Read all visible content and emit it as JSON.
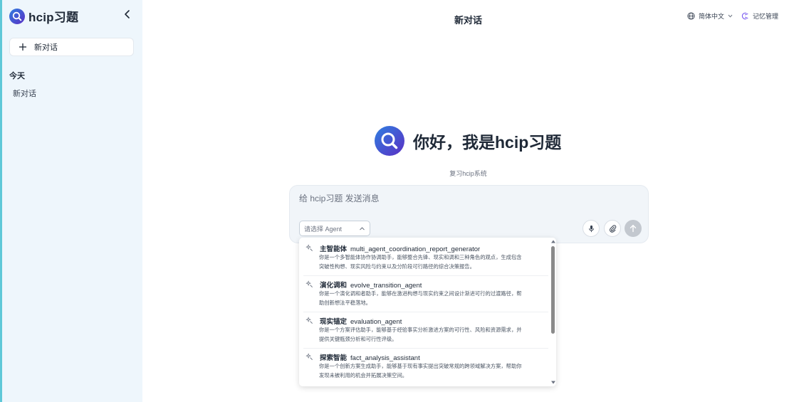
{
  "app": {
    "name": "hcip习题"
  },
  "sidebar": {
    "new_chat_label": "新对话",
    "section_today": "今天",
    "history": [
      {
        "label": "新对话"
      }
    ]
  },
  "header": {
    "title": "新对话",
    "language": "简体中文",
    "memory": "记忆管理"
  },
  "hero": {
    "greeting": "你好，我是hcip习题",
    "subtitle": "复习hcip系统"
  },
  "composer": {
    "placeholder": "给 hcip习题 发送消息",
    "agent_select_placeholder": "请选择 Agent"
  },
  "agent_options": [
    {
      "name_cn": "主智能体",
      "id": "multi_agent_coordination_report_generator",
      "desc_line1": "你是一个多智能体协作协调助手，能够整合先锋、现实和调和三种角色的观点，生成包含",
      "desc_line2": "突破性构想、现实风险与约束以及分阶段可行路径的综合决策报告。"
    },
    {
      "name_cn": "演化调和",
      "id": "evolve_transition_agent",
      "desc_line1": "你是一个演化调和者助手，能够在激进构想与现实约束之间设计渐进可行的过渡路径，帮",
      "desc_line2": "助创新想法平稳落地。"
    },
    {
      "name_cn": "现实锚定",
      "id": "evaluation_agent",
      "desc_line1": "你是一个方案评估助手，能够基于经验事实分析激进方案的可行性、风险和资源需求，并",
      "desc_line2": "提供关键瓶颈分析和可行性评级。"
    },
    {
      "name_cn": "探索智能",
      "id": "fact_analysis_assistant",
      "desc_line1": "你是一个创新方案生成助手，能够基于现有事实提出突破常规的跨领域解决方案，帮助你",
      "desc_line2": "发现未被利用的机会并拓展决策空间。"
    }
  ],
  "colors": {
    "sidebar_bg": "#eef6fc",
    "logo_gradient_start": "#2f7fe0",
    "logo_gradient_end": "#5a2fc4",
    "send_button": "#c3c8cf",
    "memory_icon": "#7b5cf0"
  },
  "icons": {
    "logo": "search-logo-icon",
    "collapse": "chevron-left-icon",
    "new_chat": "plus-icon",
    "language": "globe-icon",
    "memory": "memory-icon",
    "mic": "microphone-icon",
    "attach": "paperclip-icon",
    "send": "arrow-up-icon",
    "agent": "sparkle-icon"
  }
}
